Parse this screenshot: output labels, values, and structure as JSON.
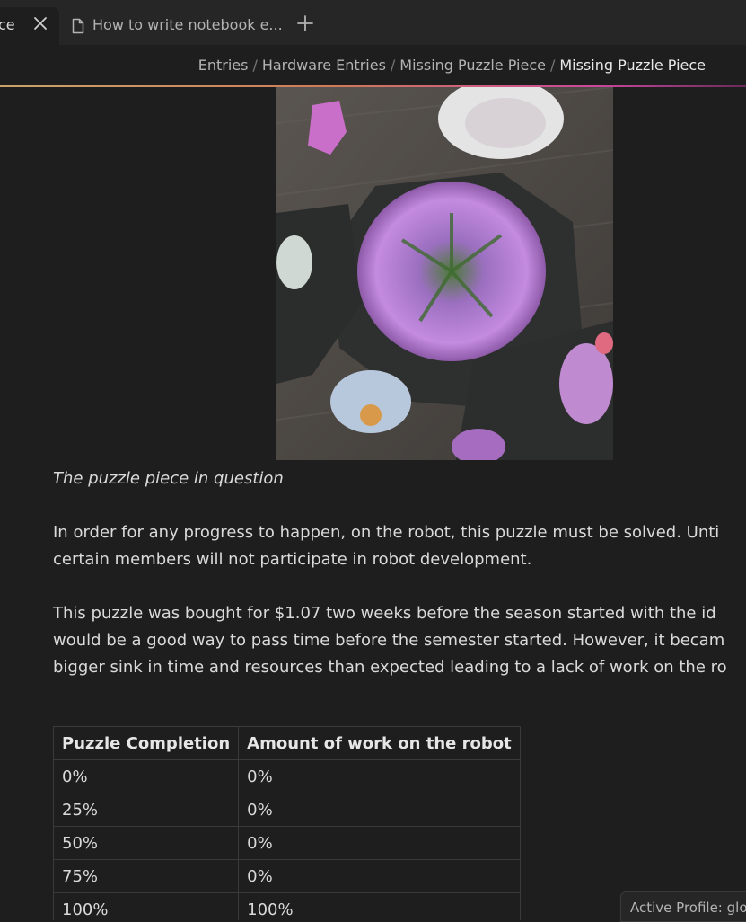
{
  "tabs": [
    {
      "title": "ce",
      "active": true
    },
    {
      "title": "How to write notebook e...",
      "active": false
    }
  ],
  "breadcrumb": [
    "Entries",
    "Hardware Entries",
    "Missing Puzzle Piece",
    "Missing Puzzle Piece"
  ],
  "breadcrumb_separator": "/",
  "content": {
    "image_caption": "The puzzle piece in question",
    "paragraph1": [
      "In order for any progress to happen, on the robot, this puzzle must be solved. Unti",
      "certain members will not participate in robot development."
    ],
    "paragraph2": [
      "This puzzle was bought for $1.07 two weeks before the season started with the id",
      "would be a good way to pass time before the semester started. However, it becam",
      "bigger sink in time and resources than expected leading to a lack of work on the ro"
    ],
    "table": {
      "headers": [
        "Puzzle Completion",
        "Amount of work on the robot"
      ],
      "rows": [
        [
          "0%",
          "0%"
        ],
        [
          "25%",
          "0%"
        ],
        [
          "50%",
          "0%"
        ],
        [
          "75%",
          "0%"
        ],
        [
          "100%",
          "100%"
        ]
      ]
    }
  },
  "status_bar": {
    "text": "Active Profile: glob"
  },
  "colors": {
    "background": "#1e1e1e",
    "tabbar": "#262626",
    "text": "#dadada",
    "muted_text": "#b3b3b3",
    "accent_gradient_start": "#c9a46a",
    "accent_gradient_end": "#c9489b"
  }
}
